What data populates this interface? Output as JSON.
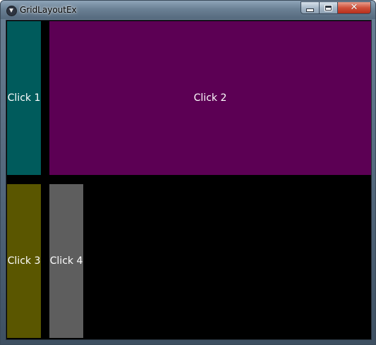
{
  "window": {
    "title": "GridLayoutEx",
    "app_icon": "kivy-app-icon",
    "controls": {
      "minimize_icon": "minimize-icon",
      "maximize_icon": "maximize-icon",
      "close_icon": "close-icon"
    }
  },
  "grid": {
    "background_color": "#000000",
    "buttons": [
      {
        "label": "Click 1",
        "color": "#005b5c"
      },
      {
        "label": "Click 2",
        "color": "#5c0054"
      },
      {
        "label": "Click 3",
        "color": "#5a5600"
      },
      {
        "label": "Click 4",
        "color": "#5e5e5e"
      }
    ]
  }
}
